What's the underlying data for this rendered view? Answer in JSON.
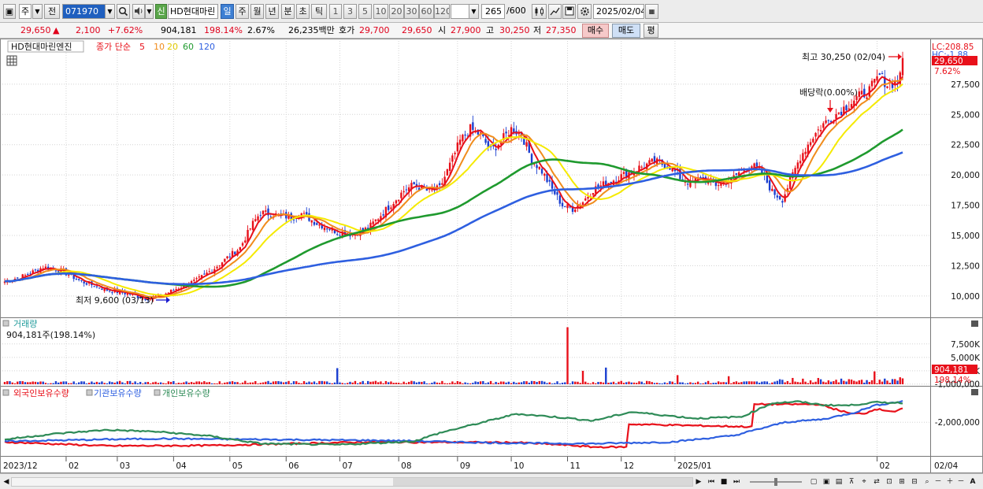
{
  "toolbar": {
    "market_type": "주",
    "prev_button": "전",
    "stock_code": "071970",
    "new_badge": "신",
    "stock_name": "HD현대마린",
    "period_tabs": [
      "일",
      "주",
      "월",
      "년",
      "분",
      "초",
      "틱"
    ],
    "active_period": "일",
    "interval_buttons": [
      "1",
      "3",
      "5",
      "10",
      "20",
      "30",
      "60",
      "120"
    ],
    "bar_count": "265",
    "bar_total": "/600",
    "date": "2025/02/04"
  },
  "quote": {
    "price": "29,650",
    "change_arrow": "▲",
    "change": "2,100",
    "change_pct": "+7.62%",
    "volume": "904,181",
    "volume_ratio": "198.14%",
    "turnover": "2.67%",
    "amount": "26,235백만",
    "bid_label": "호가",
    "ask": "29,700",
    "bid": "29,650",
    "open_label": "시",
    "open": "27,900",
    "high_label": "고",
    "high": "30,250",
    "low_label": "저",
    "low": "27,350",
    "buy_button": "매수",
    "sell_button": "매도",
    "eval_button": "평"
  },
  "price_panel": {
    "stock_name": "HD현대마린엔진",
    "ma_label": "종가 단순",
    "ma_periods": [
      "5",
      "10",
      "20",
      "60",
      "120"
    ],
    "ma_colors": [
      "#e8101a",
      "#f08c1c",
      "#f5ea00",
      "#1f9a2e",
      "#2e5fe0"
    ],
    "lc_label": "LC:208.85",
    "hc_label": "HC:-1.88",
    "current_price_tag": "29,650",
    "current_pct_tag": "7.62%",
    "high_annotation": "최고 30,250 (02/04)",
    "low_annotation": "최저 9,600 (03/13)",
    "dividend_annotation": "배당락(0.00%)",
    "y_ticks": [
      "27,500",
      "25,000",
      "22,500",
      "20,000",
      "17,500",
      "15,000",
      "12,500",
      "10,000"
    ]
  },
  "volume_panel": {
    "title": "거래량",
    "value": "904,181주(198.14%)",
    "y_ticks": [
      "7,500K",
      "5,000K",
      "2,500K"
    ],
    "current_tag": "904,181",
    "current_pct_tag": "198.14%"
  },
  "holdings_panel": {
    "legend": [
      "외국인보유수량",
      "기관보유수량",
      "개인보유수량"
    ],
    "legend_colors": [
      "#e8101a",
      "#2e5fe0",
      "#2e8b57"
    ],
    "y_ticks": [
      "-1,000,000",
      "-2,000,000"
    ]
  },
  "x_axis": {
    "labels": [
      "2023/12",
      "02",
      "03",
      "04",
      "05",
      "06",
      "07",
      "08",
      "09",
      "10",
      "11",
      "12",
      "2025/01",
      "02"
    ],
    "right_label": "02/04"
  },
  "chart_data": {
    "type": "candlestick",
    "ylim": [
      8500,
      31000
    ],
    "x_start": "2023/12",
    "x_end": "2025/02/04",
    "high": 30250,
    "high_date": "02/04",
    "low": 9600,
    "low_date": "03/13",
    "price_anchors": [
      [
        0,
        11200
      ],
      [
        8,
        11700
      ],
      [
        15,
        12400
      ],
      [
        22,
        12100
      ],
      [
        30,
        11200
      ],
      [
        40,
        10500
      ],
      [
        48,
        10200
      ],
      [
        55,
        9800
      ],
      [
        62,
        10100
      ],
      [
        68,
        10700
      ],
      [
        75,
        11300
      ],
      [
        82,
        12300
      ],
      [
        86,
        13000
      ],
      [
        92,
        14000
      ],
      [
        97,
        16000
      ],
      [
        100,
        16900
      ],
      [
        106,
        16700
      ],
      [
        112,
        16500
      ],
      [
        116,
        16800
      ],
      [
        122,
        16000
      ],
      [
        130,
        15300
      ],
      [
        136,
        15100
      ],
      [
        142,
        15600
      ],
      [
        148,
        16900
      ],
      [
        152,
        17800
      ],
      [
        156,
        18700
      ],
      [
        160,
        19200
      ],
      [
        166,
        18600
      ],
      [
        170,
        18900
      ],
      [
        174,
        20800
      ],
      [
        178,
        22800
      ],
      [
        182,
        23800
      ],
      [
        186,
        23300
      ],
      [
        190,
        22000
      ],
      [
        194,
        22800
      ],
      [
        198,
        23800
      ],
      [
        202,
        23400
      ],
      [
        206,
        21300
      ],
      [
        210,
        20300
      ],
      [
        214,
        18800
      ],
      [
        218,
        17500
      ],
      [
        222,
        17200
      ],
      [
        226,
        17800
      ],
      [
        230,
        18800
      ],
      [
        236,
        19400
      ],
      [
        242,
        20000
      ],
      [
        248,
        20600
      ],
      [
        254,
        21100
      ],
      [
        260,
        20700
      ],
      [
        264,
        19800
      ],
      [
        268,
        19300
      ],
      [
        272,
        19800
      ],
      [
        278,
        19200
      ],
      [
        284,
        19600
      ],
      [
        288,
        20400
      ],
      [
        292,
        20800
      ],
      [
        296,
        20200
      ],
      [
        300,
        18600
      ],
      [
        304,
        18000
      ],
      [
        307,
        19500
      ],
      [
        311,
        21500
      ],
      [
        316,
        23200
      ],
      [
        320,
        24200
      ],
      [
        326,
        25200
      ],
      [
        332,
        26200
      ],
      [
        338,
        27000
      ],
      [
        342,
        28200
      ],
      [
        345,
        27500
      ],
      [
        349,
        27700
      ],
      [
        351,
        29650
      ]
    ],
    "volume_spikes": [
      [
        130,
        3000
      ],
      [
        220,
        10600
      ],
      [
        226,
        2500
      ],
      [
        235,
        3100
      ],
      [
        263,
        1700
      ],
      [
        283,
        1500
      ],
      [
        340,
        2400
      ],
      [
        350,
        1300
      ]
    ],
    "series": [
      {
        "name": "5",
        "type": "moving-average"
      },
      {
        "name": "10",
        "type": "moving-average"
      },
      {
        "name": "20",
        "type": "moving-average"
      },
      {
        "name": "60",
        "type": "moving-average"
      },
      {
        "name": "120",
        "type": "moving-average"
      }
    ],
    "holdings_series": [
      {
        "name": "외국인보유수량",
        "anchors": [
          [
            0,
            -2520000
          ],
          [
            40,
            -2620000
          ],
          [
            80,
            -2610000
          ],
          [
            140,
            -2520000
          ],
          [
            200,
            -2530000
          ],
          [
            220,
            -2600000
          ],
          [
            230,
            -2650000
          ],
          [
            243,
            -2650000
          ],
          [
            244,
            -2050000
          ],
          [
            292,
            -2120000
          ],
          [
            293,
            -1530000
          ],
          [
            318,
            -1530000
          ],
          [
            331,
            -1780000
          ],
          [
            337,
            -1760000
          ],
          [
            340,
            -1650000
          ],
          [
            348,
            -1720000
          ],
          [
            351,
            -1650000
          ]
        ]
      },
      {
        "name": "기관보유수량",
        "anchors": [
          [
            0,
            -2500000
          ],
          [
            40,
            -2450000
          ],
          [
            60,
            -2430000
          ],
          [
            100,
            -2450000
          ],
          [
            150,
            -2480000
          ],
          [
            200,
            -2550000
          ],
          [
            230,
            -2560000
          ],
          [
            260,
            -2520000
          ],
          [
            285,
            -2350000
          ],
          [
            305,
            -2000000
          ],
          [
            320,
            -1920000
          ],
          [
            332,
            -1750000
          ],
          [
            340,
            -1560000
          ],
          [
            351,
            -1450000
          ]
        ]
      },
      {
        "name": "개인보유수량",
        "anchors": [
          [
            0,
            -2450000
          ],
          [
            20,
            -2300000
          ],
          [
            40,
            -2200000
          ],
          [
            60,
            -2250000
          ],
          [
            80,
            -2360000
          ],
          [
            100,
            -2560000
          ],
          [
            130,
            -2590000
          ],
          [
            160,
            -2500000
          ],
          [
            170,
            -2280000
          ],
          [
            190,
            -1950000
          ],
          [
            200,
            -1780000
          ],
          [
            215,
            -1860000
          ],
          [
            230,
            -1960000
          ],
          [
            245,
            -1730000
          ],
          [
            270,
            -1900000
          ],
          [
            288,
            -1860000
          ],
          [
            300,
            -1500000
          ],
          [
            310,
            -1460000
          ],
          [
            320,
            -1550000
          ],
          [
            330,
            -1560000
          ],
          [
            340,
            -1480000
          ],
          [
            351,
            -1490000
          ]
        ]
      }
    ]
  }
}
